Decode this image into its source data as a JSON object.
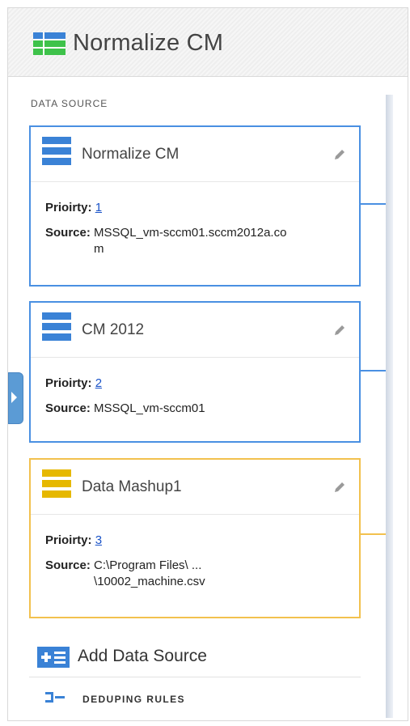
{
  "header": {
    "title": "Normalize CM"
  },
  "section": {
    "label": "DATA SOURCE"
  },
  "colors": {
    "blue": "#4a90e2",
    "yellow": "#f2c14e",
    "link": "#1a53c8"
  },
  "cards": [
    {
      "name": "Normalize CM",
      "priority_label": "Prioirty:",
      "priority": "1",
      "source_label": "Source:",
      "source": "MSSQL_vm-sccm01.sccm2012a.com",
      "color": "blue"
    },
    {
      "name": "CM 2012",
      "priority_label": "Prioirty:",
      "priority": "2",
      "source_label": "Source:",
      "source": "MSSQL_vm-sccm01",
      "color": "blue"
    },
    {
      "name": "Data Mashup1",
      "priority_label": "Prioirty:",
      "priority": "3",
      "source_label": "Source:",
      "source": "C:\\Program Files\\ ... \\10002_machine.csv",
      "color": "yellow"
    }
  ],
  "actions": {
    "add_data_source": "Add Data Source",
    "deduping_rules": "DEDUPING RULES"
  },
  "icons": {
    "title": "grid-icon",
    "card": "table-icon",
    "edit": "pencil-icon",
    "add": "add-source-icon",
    "dedup": "dedup-icon",
    "side_tab": "chevron-right-icon"
  }
}
